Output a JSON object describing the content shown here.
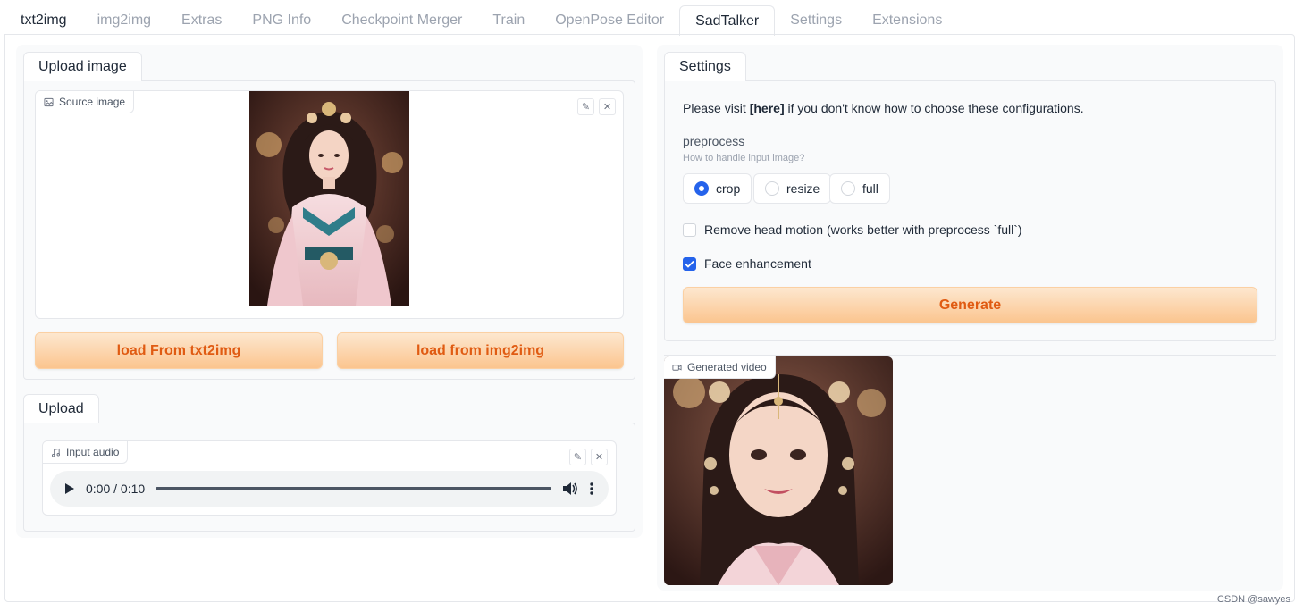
{
  "top_tabs": [
    {
      "label": "txt2img"
    },
    {
      "label": "img2img"
    },
    {
      "label": "Extras"
    },
    {
      "label": "PNG Info"
    },
    {
      "label": "Checkpoint Merger"
    },
    {
      "label": "Train"
    },
    {
      "label": "OpenPose Editor"
    },
    {
      "label": "SadTalker"
    },
    {
      "label": "Settings"
    },
    {
      "label": "Extensions"
    }
  ],
  "upload_image": {
    "tab_label": "Upload image",
    "source_label": "Source image",
    "icon": "image-icon",
    "btn_txt2img": "load From txt2img",
    "btn_img2img": "load from img2img"
  },
  "upload_audio": {
    "tab_label": "Upload",
    "input_label": "Input audio",
    "icon": "music-icon",
    "time": "0:00 / 0:10"
  },
  "settings": {
    "tab_label": "Settings",
    "info_prefix": "Please visit ",
    "info_link": "[here]",
    "info_suffix": " if you don't know how to choose these configurations.",
    "preprocess_label": "preprocess",
    "preprocess_hint": "How to handle input image?",
    "options": [
      "crop",
      "resize",
      "full"
    ],
    "selected": "crop",
    "remove_head_motion": "Remove head motion (works better with preprocess `full`)",
    "face_enhancement": "Face enhancement",
    "generate": "Generate"
  },
  "output": {
    "video_label": "Generated video",
    "icon": "video-icon"
  },
  "watermark": "CSDN @sawyes",
  "colors": {
    "accent": "#2563eb",
    "button_text": "#e05b12",
    "button_bg": "#fbc58f"
  }
}
